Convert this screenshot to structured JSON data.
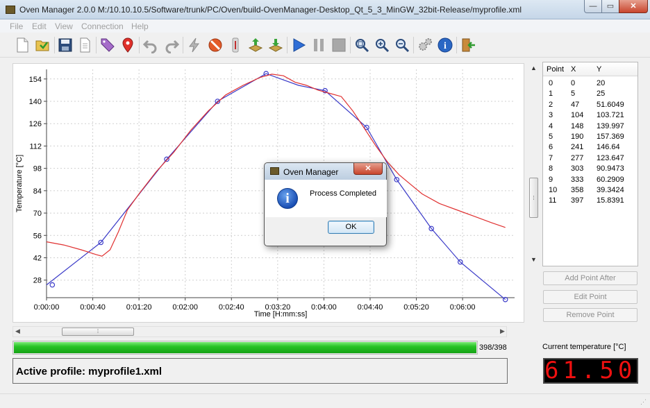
{
  "window": {
    "title": "Oven Manager 2.0.0 M:/10.10.10.5/Software/trunk/PC/Oven/build-OvenManager-Desktop_Qt_5_3_MinGW_32bit-Release/myprofile.xml",
    "min_glyph": "—",
    "max_glyph": "▭",
    "close_glyph": "✕"
  },
  "menu": [
    "File",
    "Edit",
    "View",
    "Connection",
    "Help"
  ],
  "toolbar": {
    "icons": [
      "new-file-icon",
      "open-folder-icon",
      "save-icon",
      "document-icon",
      "tag-icon",
      "location-pin-icon",
      "undo-icon",
      "redo-icon",
      "lightning-icon",
      "stop-sign-icon",
      "thermometer-icon",
      "upload-icon",
      "download-icon",
      "play-icon",
      "pause-icon",
      "stop-icon",
      "zoom-fit-icon",
      "zoom-in-icon",
      "zoom-out-icon",
      "settings-icon",
      "info-icon",
      "exit-icon"
    ]
  },
  "chart_data": {
    "type": "line",
    "xlabel": "Time [H:mm:ss]",
    "ylabel": "Temperature [°C]",
    "xlim": [
      0,
      405
    ],
    "ylim": [
      17,
      160
    ],
    "yticks": [
      28,
      42,
      56,
      70,
      84,
      98,
      112,
      126,
      140,
      154
    ],
    "xticks": [
      0,
      40,
      80,
      120,
      160,
      200,
      240,
      280,
      320,
      360
    ],
    "xtick_labels": [
      "0:00:00",
      "0:00:40",
      "0:01:20",
      "0:02:00",
      "0:02:40",
      "0:03:20",
      "0:04:00",
      "0:04:40",
      "0:05:20",
      "0:06:00"
    ],
    "grid": true,
    "series": [
      {
        "color": "#3a3ac8",
        "markers": true,
        "x": [
          0,
          47,
          104,
          148,
          190,
          218,
          241,
          277,
          303,
          333,
          358,
          397
        ],
        "y": [
          25,
          51.6049,
          103.721,
          139.997,
          157.369,
          150,
          146.64,
          123.647,
          90.9473,
          60.2909,
          39.3424,
          15.8391
        ],
        "marker_x": [
          5,
          47,
          104,
          148,
          190,
          241,
          277,
          303,
          333,
          358,
          397
        ],
        "marker_y": [
          25,
          51.6049,
          103.721,
          139.997,
          157.369,
          146.64,
          123.647,
          90.9473,
          60.2909,
          39.3424,
          15.8391
        ]
      },
      {
        "color": "#e03030",
        "markers": false,
        "x": [
          0,
          15,
          30,
          43,
          48,
          55,
          62,
          70,
          80,
          95,
          110,
          125,
          140,
          155,
          170,
          185,
          195,
          205,
          215,
          225,
          235,
          245,
          255,
          265,
          275,
          285,
          295,
          305,
          315,
          325,
          340,
          355,
          370,
          385,
          397
        ],
        "y": [
          52,
          50,
          47,
          44,
          43,
          47,
          58,
          72,
          82,
          96,
          108,
          122,
          134,
          144,
          150,
          155,
          157,
          156,
          152,
          150,
          147,
          145,
          143,
          134,
          123,
          112,
          102,
          94,
          88,
          82,
          76,
          72,
          68,
          64,
          61
        ]
      }
    ]
  },
  "points_table": {
    "headers": [
      "Point",
      "X",
      "Y"
    ],
    "rows": [
      [
        "0",
        "0",
        "20"
      ],
      [
        "1",
        "5",
        "25"
      ],
      [
        "2",
        "47",
        "51.6049"
      ],
      [
        "3",
        "104",
        "103.721"
      ],
      [
        "4",
        "148",
        "139.997"
      ],
      [
        "5",
        "190",
        "157.369"
      ],
      [
        "6",
        "241",
        "146.64"
      ],
      [
        "7",
        "277",
        "123.647"
      ],
      [
        "8",
        "303",
        "90.9473"
      ],
      [
        "9",
        "333",
        "60.2909"
      ],
      [
        "10",
        "358",
        "39.3424"
      ],
      [
        "11",
        "397",
        "15.8391"
      ]
    ]
  },
  "buttons": {
    "add_point_after": "Add Point After",
    "edit_point": "Edit Point",
    "remove_point": "Remove Point"
  },
  "progress": {
    "value": 398,
    "max": 398,
    "label": "398/398"
  },
  "active_profile": "Active profile: myprofile1.xml",
  "temperature": {
    "label": "Current temperature [°C]",
    "value": "61.50"
  },
  "dialog": {
    "title": "Oven Manager",
    "message": "Process Completed",
    "ok_label": "OK",
    "close_glyph": "✕",
    "icon_glyph": "i"
  },
  "scroll": {
    "grip_glyph": "⁞"
  }
}
